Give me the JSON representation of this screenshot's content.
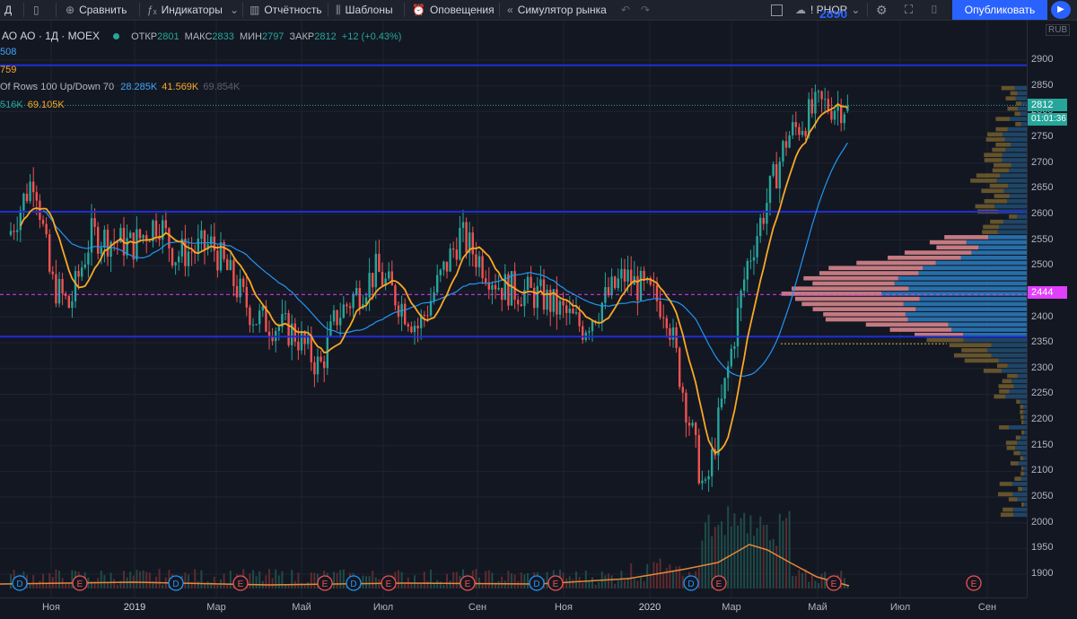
{
  "toolbar": {
    "interval": "Д",
    "compare": "Сравнить",
    "indicators": "Индикаторы",
    "financials": "Отчётность",
    "templates": "Шаблоны",
    "alerts": "Оповещения",
    "replay": "Симулятор рынка",
    "symbol": "! PHOR",
    "publish": "Опубликовать"
  },
  "legend": {
    "symbol": "АО АО · 1Д · MOEX",
    "open_label": "ОТКР",
    "open": "2801",
    "high_label": "МАКС",
    "high": "2833",
    "low_label": "МИН",
    "low": "2797",
    "close_label": "ЗАКР",
    "close": "2812",
    "change": "+12 (+0.43%)",
    "ma1": "508",
    "ma2": "759",
    "vp_title": "Of Rows 100 Up/Down 70",
    "vp_up": "28.285K",
    "vp_down": "41.569K",
    "vp_total": "69.854K",
    "vol1": "516K",
    "vol2": "69.105K"
  },
  "price_axis": {
    "currency": "RUB",
    "ticks": [
      "2900",
      "2850",
      "2800",
      "2750",
      "2700",
      "2650",
      "2600",
      "2550",
      "2500",
      "2450",
      "2400",
      "2350",
      "2300",
      "2250",
      "2200",
      "2150",
      "2100",
      "2050",
      "2000",
      "1950",
      "1900"
    ],
    "last_price": "2812",
    "countdown": "01:01:36",
    "poc_price": "2444",
    "top_partial": "2890"
  },
  "time_axis": {
    "ticks": [
      "Ноя",
      "2019",
      "Мар",
      "Май",
      "Июл",
      "Сен",
      "Ноя",
      "2020",
      "Мар",
      "Май",
      "Июл",
      "Сен"
    ]
  },
  "events": {
    "dividend": "D",
    "earnings": "E"
  },
  "colors": {
    "background": "#131722",
    "up": "#26a69a",
    "down": "#ef5350",
    "ma_fast": "#f9a825",
    "ma_slow": "#2196f3",
    "level": "#1e2fd6",
    "accent": "#2962ff",
    "poc": "#e040fb"
  },
  "chart_data": {
    "type": "candlestick",
    "symbol": "PHOR",
    "exchange": "MOEX",
    "interval": "1D",
    "ylim": [
      1880,
      2935
    ],
    "x_ticks": [
      "Ноя",
      "2019",
      "Мар",
      "Май",
      "Июл",
      "Сен",
      "Ноя",
      "2020",
      "Мар",
      "Май",
      "Июл",
      "Сен"
    ],
    "close_path": [
      [
        "2018-10",
        2560
      ],
      [
        "2018-10-20",
        2680
      ],
      [
        "2018-11",
        2470
      ],
      [
        "2018-11-15",
        2420
      ],
      [
        "2018-12",
        2560
      ],
      [
        "2019-01",
        2540
      ],
      [
        "2019-01-20",
        2590
      ],
      [
        "2019-02",
        2520
      ],
      [
        "2019-03",
        2540
      ],
      [
        "2019-04",
        2400
      ],
      [
        "2019-05",
        2370
      ],
      [
        "2019-05-20",
        2300
      ],
      [
        "2019-06",
        2400
      ],
      [
        "2019-07",
        2490
      ],
      [
        "2019-08",
        2380
      ],
      [
        "2019-09",
        2560
      ],
      [
        "2019-10",
        2460
      ],
      [
        "2019-11",
        2440
      ],
      [
        "2019-12",
        2380
      ],
      [
        "2020-01",
        2480
      ],
      [
        "2020-02",
        2420
      ],
      [
        "2020-03",
        2050
      ],
      [
        "2020-04",
        2500
      ],
      [
        "2020-05",
        2750
      ],
      [
        "2020-05-25",
        2812
      ]
    ],
    "levels": [
      2890,
      2605,
      2362
    ],
    "point_of_control": 2444,
    "last": 2812
  }
}
